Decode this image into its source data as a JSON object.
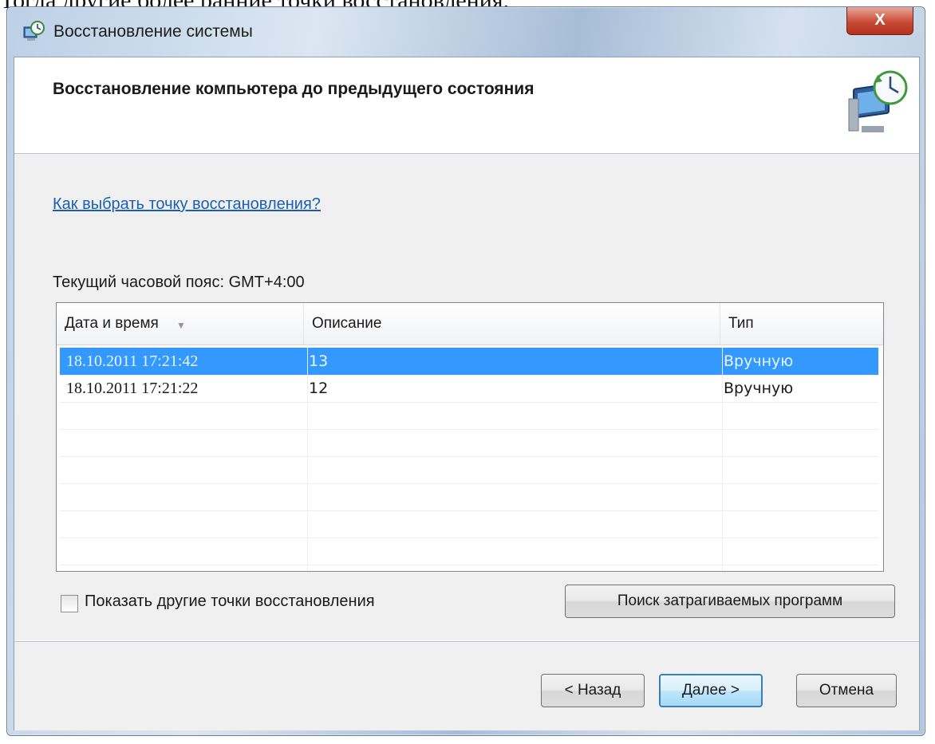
{
  "document": {
    "text_above": "Тогда другие более ранние точки восстановления."
  },
  "window": {
    "title": "Восстановление системы",
    "close_label": "X"
  },
  "header": {
    "title": "Восстановление компьютера до предыдущего состояния"
  },
  "content": {
    "help_link": "Как выбрать точку восстановления?",
    "timezone_label": "Текущий часовой пояс: GMT+4:00",
    "table": {
      "columns": [
        "Дата и время",
        "Описание",
        "Тип"
      ],
      "rows": [
        {
          "datetime": "18.10.2011 17:21:42",
          "description": "13",
          "type": "Вручную",
          "selected": true
        },
        {
          "datetime": "18.10.2011 17:21:22",
          "description": "12",
          "type": "Вручную",
          "selected": false
        }
      ]
    },
    "show_more_checkbox": {
      "label": "Показать другие точки восстановления",
      "checked": false
    },
    "search_button": "Поиск затрагиваемых программ"
  },
  "footer": {
    "back": "< Назад",
    "next": "Далее >",
    "cancel": "Отмена"
  },
  "colors": {
    "selection": "#3399ff",
    "link": "#1a5fb4",
    "close_button": "#c94b36"
  }
}
